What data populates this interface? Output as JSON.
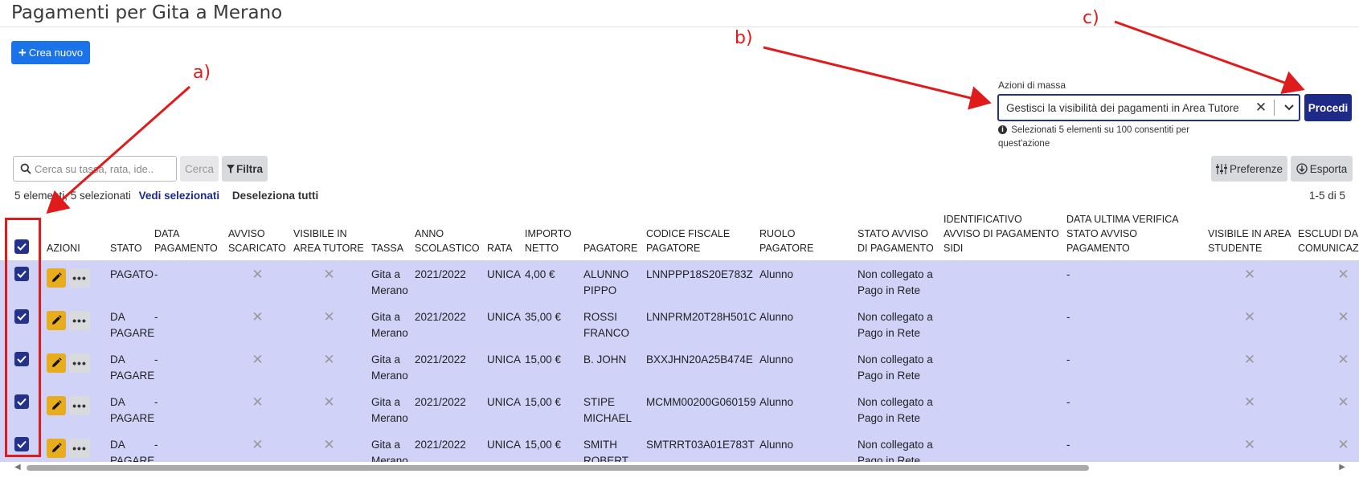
{
  "page": {
    "title": "Pagamenti per Gita a Merano"
  },
  "toolbar": {
    "create_label": "Crea nuovo"
  },
  "mass_actions": {
    "label": "Azioni di massa",
    "selected_value": "Gestisci la visibilità dei pagamenti in Area Tutore",
    "hint": "Selezionati 5 elementi su 100 consentiti per quest'azione",
    "proceed_label": "Procedi"
  },
  "search": {
    "placeholder": "Cerca su tassa, rata, ide..",
    "button_label": "Cerca"
  },
  "filter": {
    "label": "Filtra"
  },
  "preferences": {
    "label": "Preferenze"
  },
  "export": {
    "label": "Esporta"
  },
  "selection": {
    "count_text": "5 elementi, 5 selezionati",
    "view_selected": "Vedi selezionati",
    "deselect_all": "Deseleziona tutti",
    "pagination": "1-5 di 5"
  },
  "table": {
    "columns": [
      "Azioni",
      "Stato",
      "Data pagamento",
      "Avviso scaricato",
      "Visibile in Area Tutore",
      "Tassa",
      "Anno scolastico",
      "Rata",
      "Importo netto",
      "Pagatore",
      "Codice fiscale pagatore",
      "Ruolo pagatore",
      "Stato avviso di pagamento",
      "Identificativo avviso di pagamento SIDI",
      "Data ultima verifica stato avviso pagamento",
      "Visibile in Area Studente",
      "Escludi da comunicaz"
    ],
    "rows": [
      {
        "stato": "PAGATO",
        "data_pagamento": "-",
        "tassa": "Gita a Merano",
        "anno": "2021/2022",
        "rata": "UNICA",
        "importo": "4,00 €",
        "pagatore": "ALUNNO PIPPO",
        "codice_fiscale": "LNNPPP18S20E783Z",
        "ruolo": "Alunno",
        "stato_avviso": "Non collegato a Pago in Rete",
        "data_verifica": "-"
      },
      {
        "stato": "DA PAGARE",
        "data_pagamento": "-",
        "tassa": "Gita a Merano",
        "anno": "2021/2022",
        "rata": "UNICA",
        "importo": "35,00 €",
        "pagatore": "ROSSI FRANCO",
        "codice_fiscale": "LNNPRM20T28H501C",
        "ruolo": "Alunno",
        "stato_avviso": "Non collegato a Pago in Rete",
        "data_verifica": "-"
      },
      {
        "stato": "DA PAGARE",
        "data_pagamento": "-",
        "tassa": "Gita a Merano",
        "anno": "2021/2022",
        "rata": "UNICA",
        "importo": "15,00 €",
        "pagatore": "B. JOHN",
        "codice_fiscale": "BXXJHN20A25B474E",
        "ruolo": "Alunno",
        "stato_avviso": "Non collegato a Pago in Rete",
        "data_verifica": "-"
      },
      {
        "stato": "DA PAGARE",
        "data_pagamento": "-",
        "tassa": "Gita a Merano",
        "anno": "2021/2022",
        "rata": "UNICA",
        "importo": "15,00 €",
        "pagatore": "STIPE MICHAEL",
        "codice_fiscale": "MCMM00200G060159",
        "ruolo": "Alunno",
        "stato_avviso": "Non collegato a Pago in Rete",
        "data_verifica": "-"
      },
      {
        "stato": "DA PAGARE",
        "data_pagamento": "-",
        "tassa": "Gita a Merano",
        "anno": "2021/2022",
        "rata": "UNICA",
        "importo": "15,00 €",
        "pagatore": "SMITH ROBERT",
        "codice_fiscale": "SMTRRT03A01E783T",
        "ruolo": "Alunno",
        "stato_avviso": "Non collegato a Pago in Rete",
        "data_verifica": "-"
      }
    ]
  },
  "annotations": {
    "a": "a)",
    "b": "b)",
    "c": "c)"
  },
  "icons": {
    "create": "plus-icon",
    "clear": "close-icon",
    "dropdown": "chevron-down-icon",
    "info": "info-icon",
    "search": "search-icon",
    "filter": "funnel-icon",
    "preferences": "sliders-icon",
    "export": "download-icon",
    "check": "check-icon",
    "edit": "pencil-icon",
    "more": "more-icon",
    "boolean_false": "x-icon"
  },
  "colors": {
    "primary": "#1a73e8",
    "navy": "#1e2a87",
    "row_selected": "#d0d2f8",
    "edit_button": "#e8ad1c",
    "annotation": "#e01b1b"
  }
}
